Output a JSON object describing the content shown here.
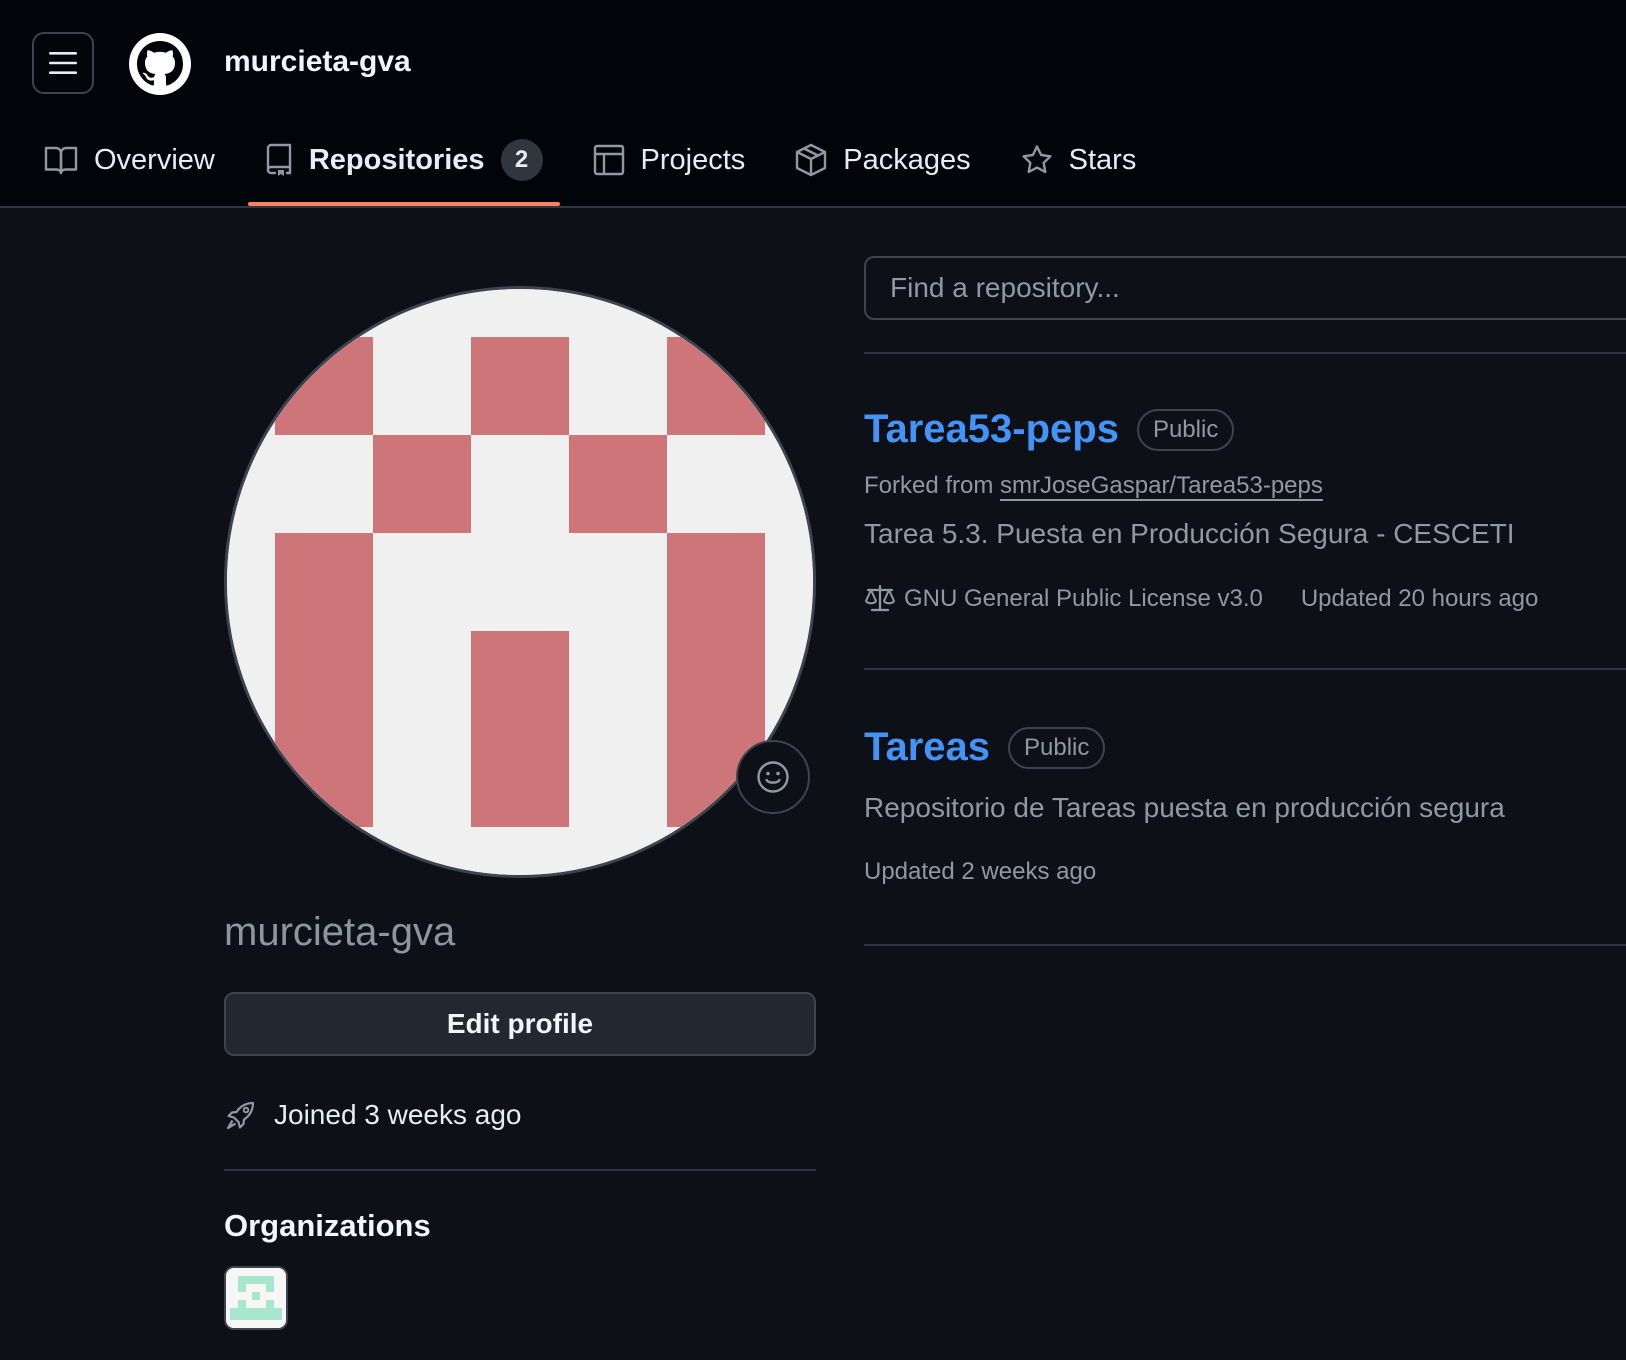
{
  "header": {
    "username": "murcieta-gva"
  },
  "tabs": [
    {
      "label": "Overview",
      "icon": "book-icon"
    },
    {
      "label": "Repositories",
      "icon": "repo-icon",
      "count": "2",
      "active": true
    },
    {
      "label": "Projects",
      "icon": "table-icon"
    },
    {
      "label": "Packages",
      "icon": "package-icon"
    },
    {
      "label": "Stars",
      "icon": "star-icon"
    }
  ],
  "profile": {
    "display_name": "murcieta-gva",
    "edit_label": "Edit profile",
    "joined": "Joined 3 weeks ago",
    "organizations_heading": "Organizations"
  },
  "search": {
    "placeholder": "Find a repository..."
  },
  "repos": [
    {
      "name": "Tarea53-peps",
      "visibility": "Public",
      "forked_prefix": "Forked from",
      "forked_from": "smrJoseGaspar/Tarea53-peps",
      "description": "Tarea 5.3. Puesta en Producción Segura - CESCETI",
      "license": "GNU General Public License v3.0",
      "updated": "Updated 20 hours ago"
    },
    {
      "name": "Tareas",
      "visibility": "Public",
      "description": "Repositorio de Tareas puesta en producción segura",
      "updated": "Updated 2 weeks ago"
    }
  ],
  "colors": {
    "background": "#0d1117",
    "header_bg": "#010409",
    "link_blue": "#4493f8",
    "tab_underline": "#f78166",
    "avatar_pink": "#cd7579",
    "org_avatar_green": "#a8e6cf"
  }
}
